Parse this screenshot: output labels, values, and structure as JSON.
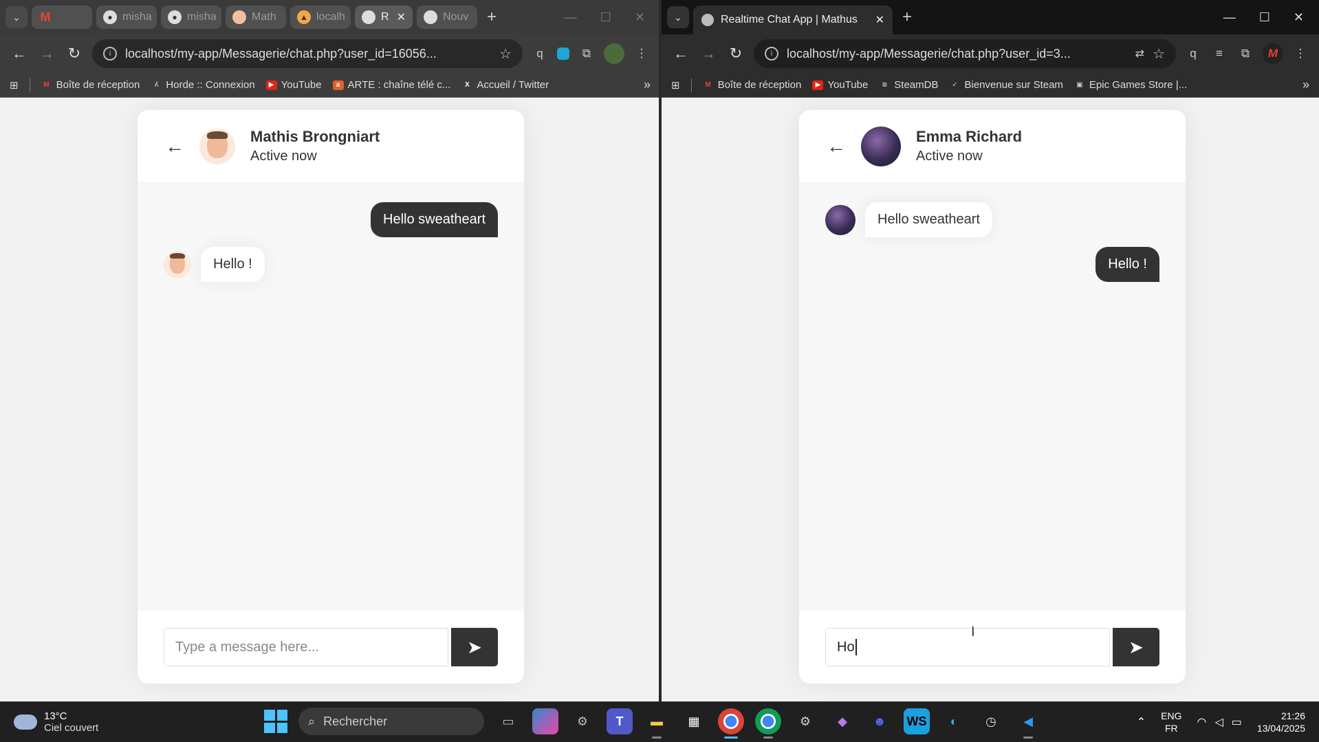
{
  "left_window": {
    "tabs": [
      {
        "label": "",
        "icon": "gmail-icon"
      },
      {
        "label": "misha",
        "icon": "github-icon"
      },
      {
        "label": "misha",
        "icon": "github-icon"
      },
      {
        "label": "Math",
        "icon": "avatar-icon"
      },
      {
        "label": "localh",
        "icon": "localhost-icon"
      },
      {
        "label": "R",
        "icon": "globe-icon",
        "active": true
      },
      {
        "label": "Nouv",
        "icon": "globe-icon"
      }
    ],
    "url": "localhost/my-app/Messagerie/chat.php?user_id=16056...",
    "bookmarks": [
      "Boîte de réception",
      "Horde :: Connexion",
      "YouTube",
      "ARTE : chaîne télé c...",
      "Accueil / Twitter"
    ],
    "chat": {
      "name": "Mathis Brongniart",
      "status": "Active now",
      "messages": [
        {
          "direction": "outgoing",
          "text": "Hello sweatheart"
        },
        {
          "direction": "incoming",
          "text": "Hello !"
        }
      ],
      "input_value": "",
      "input_placeholder": "Type a message here..."
    }
  },
  "right_window": {
    "tab_title": "Realtime Chat App | Mathus",
    "url": "localhost/my-app/Messagerie/chat.php?user_id=3...",
    "bookmarks": [
      "Boîte de réception",
      "YouTube",
      "SteamDB",
      "Bienvenue sur Steam",
      "Epic Games Store |..."
    ],
    "chat": {
      "name": "Emma Richard",
      "status": "Active now",
      "messages": [
        {
          "direction": "incoming",
          "text": "Hello sweatheart"
        },
        {
          "direction": "outgoing",
          "text": "Hello !"
        }
      ],
      "input_value": "Ho",
      "input_placeholder": ""
    }
  },
  "taskbar": {
    "temperature": "13°C",
    "weather": "Ciel couvert",
    "search_label": "Rechercher",
    "lang_top": "ENG",
    "lang_bottom": "FR",
    "time": "21:26",
    "date": "13/04/2025"
  }
}
